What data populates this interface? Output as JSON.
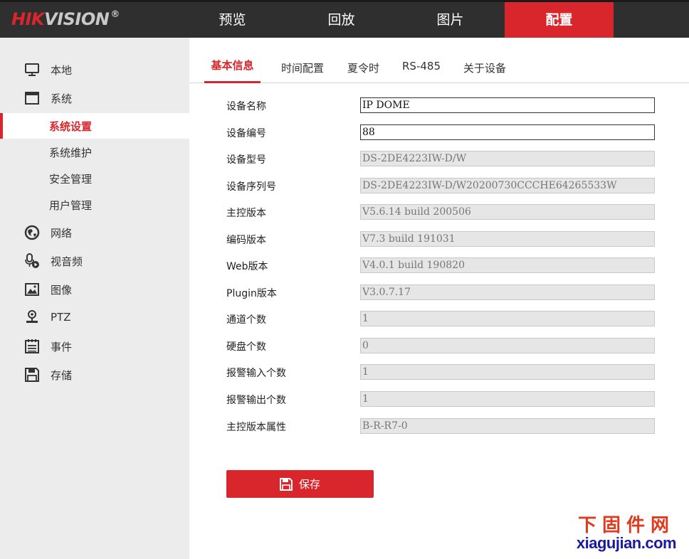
{
  "brand": {
    "name_red": "HIK",
    "name_gray": "VISION",
    "reg": "®"
  },
  "nav": [
    {
      "label": "预览"
    },
    {
      "label": "回放"
    },
    {
      "label": "图片"
    },
    {
      "label": "配置"
    }
  ],
  "sidebar": {
    "items": [
      {
        "label": "本地",
        "icon": "monitor-icon"
      },
      {
        "label": "系统",
        "icon": "window-icon"
      },
      {
        "label": "系统设置"
      },
      {
        "label": "系统维护"
      },
      {
        "label": "安全管理"
      },
      {
        "label": "用户管理"
      },
      {
        "label": "网络",
        "icon": "globe-icon"
      },
      {
        "label": "视音频",
        "icon": "microphone-icon"
      },
      {
        "label": "图像",
        "icon": "image-icon"
      },
      {
        "label": "PTZ",
        "icon": "ptz-camera-icon"
      },
      {
        "label": "事件",
        "icon": "calendar-icon"
      },
      {
        "label": "存储",
        "icon": "floppy-disk-icon"
      }
    ]
  },
  "tabs": [
    {
      "label": "基本信息"
    },
    {
      "label": "时间配置"
    },
    {
      "label": "夏令时"
    },
    {
      "label": "RS-485"
    },
    {
      "label": "关于设备"
    }
  ],
  "form": {
    "rows": [
      {
        "label": "设备名称",
        "value": "IP DOME"
      },
      {
        "label": "设备编号",
        "value": "88"
      },
      {
        "label": "设备型号",
        "value": "DS-2DE4223IW-D/W"
      },
      {
        "label": "设备序列号",
        "value": "DS-2DE4223IW-D/W20200730CCCHE64265533W"
      },
      {
        "label": "主控版本",
        "value": "V5.6.14 build 200506"
      },
      {
        "label": "编码版本",
        "value": "V7.3 build 191031"
      },
      {
        "label": "Web版本",
        "value": "V4.0.1 build 190820"
      },
      {
        "label": "Plugin版本",
        "value": "V3.0.7.17"
      },
      {
        "label": "通道个数",
        "value": "1"
      },
      {
        "label": "硬盘个数",
        "value": "0"
      },
      {
        "label": "报警输入个数",
        "value": "1"
      },
      {
        "label": "报警输出个数",
        "value": "1"
      },
      {
        "label": "主控版本属性",
        "value": "B-R-R7-0"
      }
    ],
    "save_label": "保存"
  },
  "watermark": {
    "cn": "下固件网",
    "en": "xiagujian.com"
  },
  "colors": {
    "accent": "#d9262c",
    "topbar": "#2f2f2f",
    "sidebar": "#ececec"
  }
}
